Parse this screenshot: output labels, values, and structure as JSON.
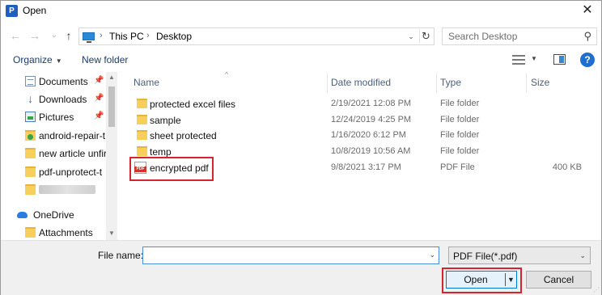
{
  "window": {
    "title": "Open",
    "app_icon": "P",
    "close_icon": "close-icon"
  },
  "nav": {
    "back_icon": "←",
    "forward_icon": "→",
    "recent_icon": "⌄",
    "up_icon": "↑",
    "breadcrumb": [
      "This PC",
      "Desktop"
    ],
    "search_placeholder": "Search Desktop"
  },
  "toolbar": {
    "organize": "Organize",
    "new_folder": "New folder",
    "help": "?"
  },
  "sidebar": {
    "items": [
      {
        "label": "Documents",
        "icon": "documents-icon",
        "pinned": true
      },
      {
        "label": "Downloads",
        "icon": "downloads-icon",
        "pinned": true
      },
      {
        "label": "Pictures",
        "icon": "pictures-icon",
        "pinned": true
      },
      {
        "label": "android-repair-t",
        "icon": "folder-icon",
        "pinned": false
      },
      {
        "label": "new article unfir",
        "icon": "folder-icon",
        "pinned": false
      },
      {
        "label": "pdf-unprotect-t",
        "icon": "folder-icon",
        "pinned": false
      },
      {
        "label": "",
        "icon": "blurred-folder",
        "pinned": false
      },
      {
        "label": "OneDrive",
        "icon": "onedrive-icon",
        "pinned": false
      },
      {
        "label": "Attachments",
        "icon": "folder-icon",
        "pinned": false
      }
    ]
  },
  "columns": {
    "name": "Name",
    "date": "Date modified",
    "type": "Type",
    "size": "Size"
  },
  "files": [
    {
      "name": "protected excel files",
      "date": "2/19/2021 12:08 PM",
      "type": "File folder",
      "size": ""
    },
    {
      "name": "sample",
      "date": "12/24/2019 4:25 PM",
      "type": "File folder",
      "size": ""
    },
    {
      "name": "sheet protected",
      "date": "1/16/2020 6:12 PM",
      "type": "File folder",
      "size": ""
    },
    {
      "name": "temp",
      "date": "10/8/2019 10:56 AM",
      "type": "File folder",
      "size": ""
    },
    {
      "name": "encrypted pdf",
      "date": "9/8/2021 3:17 PM",
      "type": "PDF File",
      "size": "400 KB"
    }
  ],
  "pdf_badge": "PDF",
  "bottom": {
    "file_name_label": "File name:",
    "file_name_value": "",
    "filter": "PDF File(*.pdf)",
    "open": "Open",
    "cancel": "Cancel"
  },
  "colors": {
    "highlight": "#d3242f",
    "accent": "#0078d7"
  }
}
